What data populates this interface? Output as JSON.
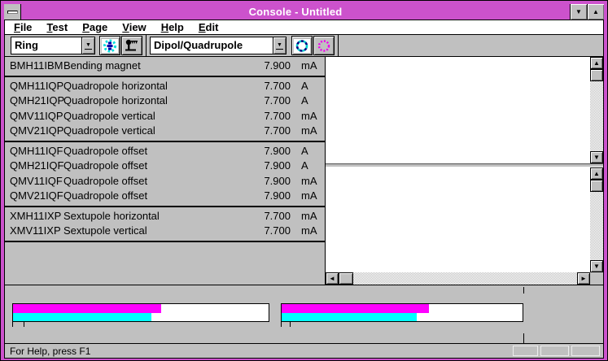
{
  "window": {
    "title": "Console - Untitled"
  },
  "menu": {
    "items": [
      "File",
      "Test",
      "Page",
      "View",
      "Help",
      "Edit"
    ]
  },
  "toolbar": {
    "ring_combobox": {
      "value": "Ring"
    },
    "magnet_combobox": {
      "value": "Dipol/Quadrupole"
    }
  },
  "table": {
    "groups": [
      {
        "rows": [
          {
            "id": "BMH11IBM",
            "desc": "Bending magnet",
            "value": "7.900",
            "unit": "mA"
          }
        ]
      },
      {
        "rows": [
          {
            "id": "QMH11IQP",
            "desc": "Quadropole horizontal",
            "value": "7.700",
            "unit": "A"
          },
          {
            "id": "QMH21IQP",
            "desc": "Quadropole horizontal",
            "value": "7.700",
            "unit": "A"
          },
          {
            "id": "QMV11IQP",
            "desc": "Quadropole vertical",
            "value": "7.700",
            "unit": "mA"
          },
          {
            "id": "QMV21IQP",
            "desc": "Quadropole vertical",
            "value": "7.700",
            "unit": "mA"
          }
        ]
      },
      {
        "rows": [
          {
            "id": "QMH11IQF",
            "desc": "Quadropole offset",
            "value": "7.900",
            "unit": "A"
          },
          {
            "id": "QMH21IQF",
            "desc": "Quadropole offset",
            "value": "7.900",
            "unit": "A"
          },
          {
            "id": "QMV11IQF",
            "desc": "Quadropole offset",
            "value": "7.900",
            "unit": "mA"
          },
          {
            "id": "QMV21IQF",
            "desc": "Quadropole offset",
            "value": "7.900",
            "unit": "mA"
          }
        ]
      },
      {
        "rows": [
          {
            "id": "XMH11IXP",
            "desc": "Sextupole horizontal",
            "value": "7.700",
            "unit": "mA"
          },
          {
            "id": "XMV11IXP",
            "desc": "Sextupole vertical",
            "value": "7.700",
            "unit": "mA"
          }
        ]
      }
    ]
  },
  "meters": {
    "bars": [
      {
        "magenta_pct": 58,
        "cyan_pct": 54
      },
      {
        "magenta_pct": 61,
        "cyan_pct": 56
      }
    ],
    "colors": {
      "magenta": "#ff00ff",
      "cyan": "#00ffff"
    }
  },
  "statusbar": {
    "message": "For Help, press F1"
  },
  "glyphs": {
    "minimize": "▼",
    "maximize": "▲",
    "combo_arrow": "▼",
    "scroll_up": "▲",
    "scroll_down": "▼",
    "scroll_left": "◄",
    "scroll_right": "►"
  },
  "colors": {
    "titlebar": "#cc52cc",
    "face": "#c0c0c0"
  }
}
